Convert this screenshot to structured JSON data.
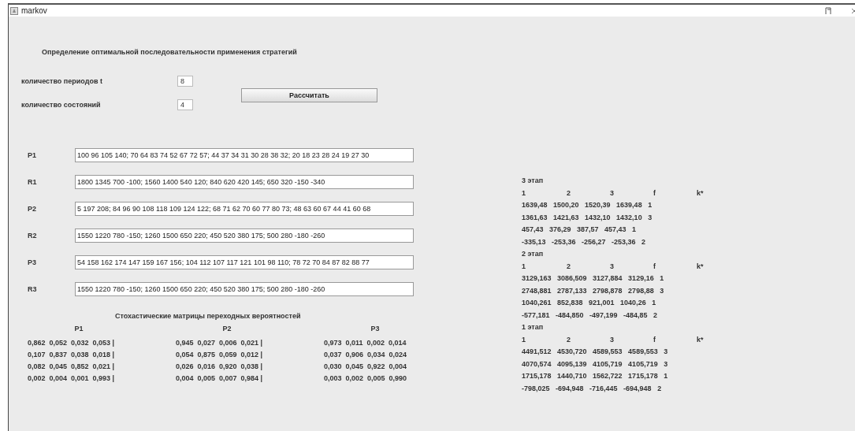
{
  "window": {
    "title": "markov"
  },
  "heading": "Определение оптимальной последовательности применения стратегий",
  "settings": [
    {
      "label": "количество периодов t",
      "value": "8"
    },
    {
      "label": "количество состояний",
      "value": "4"
    }
  ],
  "calculate_button": "Рассчитать",
  "inputs": [
    {
      "label": "P1",
      "value": "100 96 105 140; 70 64 83 74 52 67 72 57; 44 37 34 31 30 28 38 32; 20 18 23 28 24 19 27 30"
    },
    {
      "label": "R1",
      "value": "1800 1345 700 -100; 1560 1400 540 120; 840 620 420 145; 650 320 -150 -340"
    },
    {
      "label": "P2",
      "value": "5 197 208; 84 96 90 108 118 109 124 122; 68 71 62 70 60 77 80 73; 48 63 60 67 44 41 60 68"
    },
    {
      "label": "R2",
      "value": "1550 1220 780 -150; 1260 1500 650 220; 450 520 380 175; 500 280 -180 -260"
    },
    {
      "label": "P3",
      "value": "54 158 162 174 147 159 167 156; 104 112 107 117 121 101 98 110; 78 72 70 84 87 82 88 77"
    },
    {
      "label": "R3",
      "value": "1550 1220 780 -150; 1260 1500 650 220; 450 520 380 175; 500 280 -180 -260"
    }
  ],
  "matrices": {
    "title": "Стохастические матрицы переходных вероятностей",
    "items": [
      {
        "name": "P1",
        "rows": [
          "0,862  0,052  0,032  0,053 |",
          "0,107  0,837  0,038  0,018 |",
          "0,082  0,045  0,852  0,021 |",
          "0,002  0,004  0,001  0,993 |"
        ]
      },
      {
        "name": "P2",
        "rows": [
          "0,945  0,027  0,006  0,021 |",
          "0,054  0,875  0,059  0,012 |",
          "0,026  0,016  0,920  0,038 |",
          "0,004  0,005  0,007  0,984 |"
        ]
      },
      {
        "name": "P3",
        "rows": [
          "0,973  0,011  0,002  0,014",
          "0,037  0,906  0,034  0,024",
          "0,030  0,045  0,922  0,004",
          "0,003  0,002  0,005  0,990"
        ]
      }
    ]
  },
  "stages": [
    {
      "title": "3 этап",
      "header": [
        "1",
        "2",
        "3",
        "f",
        "k*"
      ],
      "rows": [
        "1639,48   1500,20   1520,39   1639,48   1",
        "1361,63   1421,63   1432,10   1432,10   3",
        "457,43   376,29   387,57   457,43   1",
        "-335,13   -253,36   -256,27   -253,36   2"
      ]
    },
    {
      "title": "2 этап",
      "header": [
        "1",
        "2",
        "3",
        "f",
        "k*"
      ],
      "rows": [
        "3129,163   3086,509   3127,884   3129,16   1",
        "2748,881   2787,133   2798,878   2798,88   3",
        "1040,261   852,838   921,001   1040,26   1",
        "-577,181   -484,850   -497,199   -484,85   2"
      ]
    },
    {
      "title": "1 этап",
      "header": [
        "1",
        "2",
        "3",
        "f",
        "k*"
      ],
      "rows": [
        "4491,512   4530,720   4589,553   4589,553   3",
        "4070,574   4095,139   4105,719   4105,719   3",
        "1715,178   1440,710   1562,722   1715,178   1",
        "-798,025   -694,948   -716,445   -694,948   2"
      ]
    }
  ]
}
